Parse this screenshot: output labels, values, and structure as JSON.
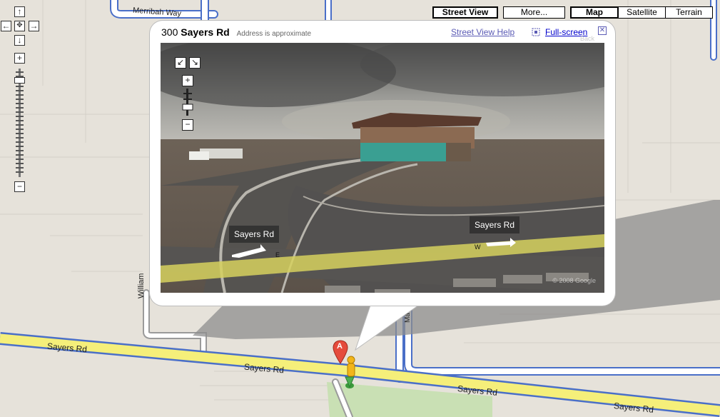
{
  "map_controls": {
    "pan_up": "↑",
    "pan_left": "←",
    "pan_center": "✥",
    "pan_right": "→",
    "pan_down": "↓",
    "zoom_in": "+",
    "zoom_out": "−"
  },
  "map_types": {
    "street_view": "Street View",
    "more": "More...",
    "map": "Map",
    "satellite": "Satellite",
    "terrain": "Terrain",
    "selected": "Map"
  },
  "roads": {
    "merribah": "Merribah Way",
    "sayers_left": "Sayers Rd",
    "sayers_mid": "Sayers Rd",
    "sayers_right1": "Sayers Rd",
    "sayers_right2": "Sayers Rd",
    "williams": "William",
    "ma": "Ma"
  },
  "marker": {
    "letter": "A"
  },
  "bubble": {
    "number": "300",
    "street": "Sayers Rd",
    "approx": "Address is approximate",
    "help": "Street View Help",
    "fullscreen": "Full-screen",
    "close": "✕",
    "pegman_label": "Back"
  },
  "panorama": {
    "controls": {
      "nav_sw": "↙",
      "nav_se": "↘",
      "zoom_in": "+",
      "zoom_out": "−"
    },
    "tag_left": "Sayers Rd",
    "tag_right": "Sayers Rd",
    "dir_e": "E",
    "dir_w": "W",
    "copyright": "© 2008 Google"
  },
  "colors": {
    "map_bg": "#e8e4dc",
    "major_road": "#f5ef7a",
    "road_outline": "#4a6fc8",
    "minor_road": "#ffffff",
    "park": "#c9e0b4"
  }
}
